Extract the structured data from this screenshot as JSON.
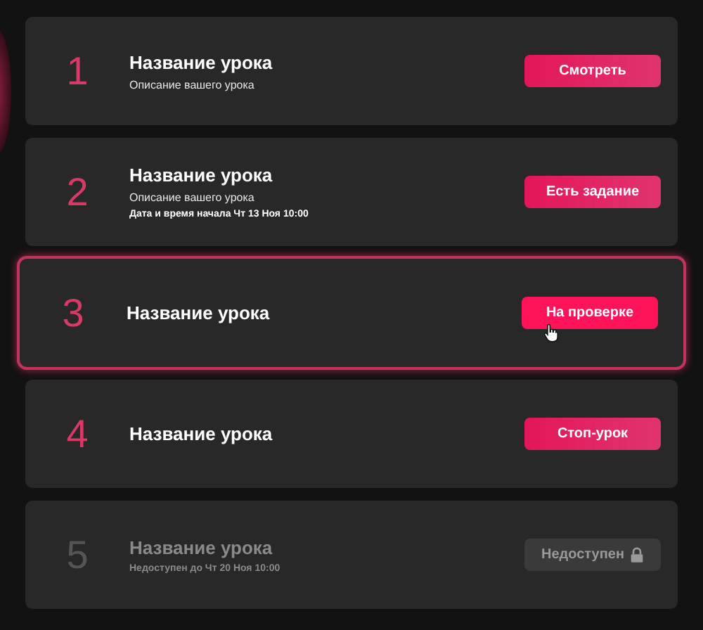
{
  "lessons": [
    {
      "number": "1",
      "title": "Название урока",
      "description": "Описание вашего урока",
      "button": "Смотреть",
      "hovered": false,
      "disabled": false
    },
    {
      "number": "2",
      "title": "Название урока",
      "description": "Описание вашего урока",
      "meta": "Дата и время начала Чт 13 Ноя 10:00",
      "button": "Есть задание",
      "hovered": false,
      "disabled": false
    },
    {
      "number": "3",
      "title": "Название урока",
      "button": "На проверке",
      "hovered": true,
      "disabled": false
    },
    {
      "number": "4",
      "title": "Название урока",
      "button": "Стоп-урок",
      "hovered": false,
      "disabled": false
    },
    {
      "number": "5",
      "title": "Название урока",
      "meta": "Недоступен до Чт 20 Ноя 10:00",
      "button": "Недоступен",
      "hovered": false,
      "disabled": true
    }
  ]
}
